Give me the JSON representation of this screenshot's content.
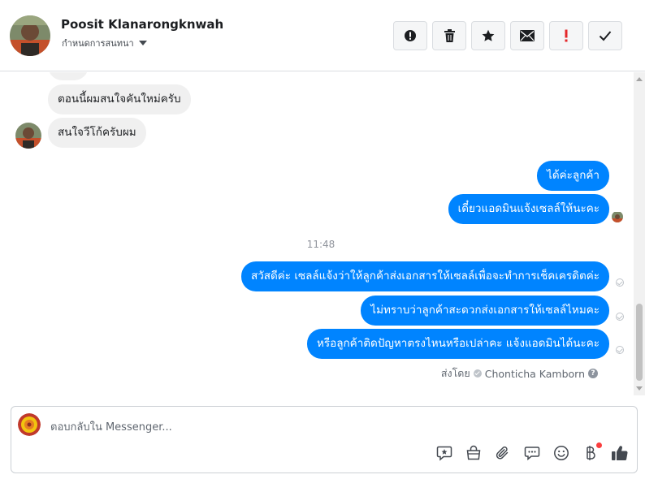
{
  "header": {
    "contact_name": "Poosit Klanarongknwah",
    "assign_label": "กำหนดการสนทนา",
    "actions": [
      {
        "name": "spam-button",
        "icon": "alert-icon"
      },
      {
        "name": "delete-button",
        "icon": "trash-icon"
      },
      {
        "name": "star-button",
        "icon": "star-icon"
      },
      {
        "name": "mark-unread-button",
        "icon": "envelope-icon"
      },
      {
        "name": "important-button",
        "icon": "exclamation-icon"
      },
      {
        "name": "done-button",
        "icon": "check-icon"
      }
    ]
  },
  "thread": {
    "incoming": [
      {
        "text": "ตอนนี้ผมสนใจคันใหม่ครับ"
      },
      {
        "text": "สนใจวีโก้ครับผม"
      }
    ],
    "outgoing_1": [
      {
        "text": "ได้ค่ะลูกค้า"
      },
      {
        "text": "เดี๋ยวแอดมินแจ้งเซลล์ให้นะคะ"
      }
    ],
    "time_separator": "11:48",
    "outgoing_2": [
      {
        "text": "สวัสดีค่ะ เซลล์แจ้งว่าให้ลูกค้าส่งเอกสารให้เซลล์เพื่อจะทำการเช็คเครดิตค่ะ"
      },
      {
        "text": "ไม่ทราบว่าลูกค้าสะดวกส่งเอกสารให้เซลล์ไหมคะ"
      },
      {
        "text": "หรือลูกค้าติดปัญหาตรงไหนหรือเปล่าคะ แจ้งแอดมินได้นะคะ"
      }
    ],
    "sent_by_label": "ส่งโดย",
    "sent_by_name": "Chonticha Kamborn",
    "help_symbol": "?"
  },
  "composer": {
    "placeholder": "ตอบกลับใน Messenger...",
    "tools": [
      "saved-reply-icon",
      "shop-bag-icon",
      "attachment-icon",
      "chat-icon",
      "emoji-icon",
      "payment-icon",
      "like-icon"
    ]
  },
  "colors": {
    "accent": "#0084ff",
    "incoming_bg": "#f0f0f0",
    "important_red": "#e4272a"
  }
}
